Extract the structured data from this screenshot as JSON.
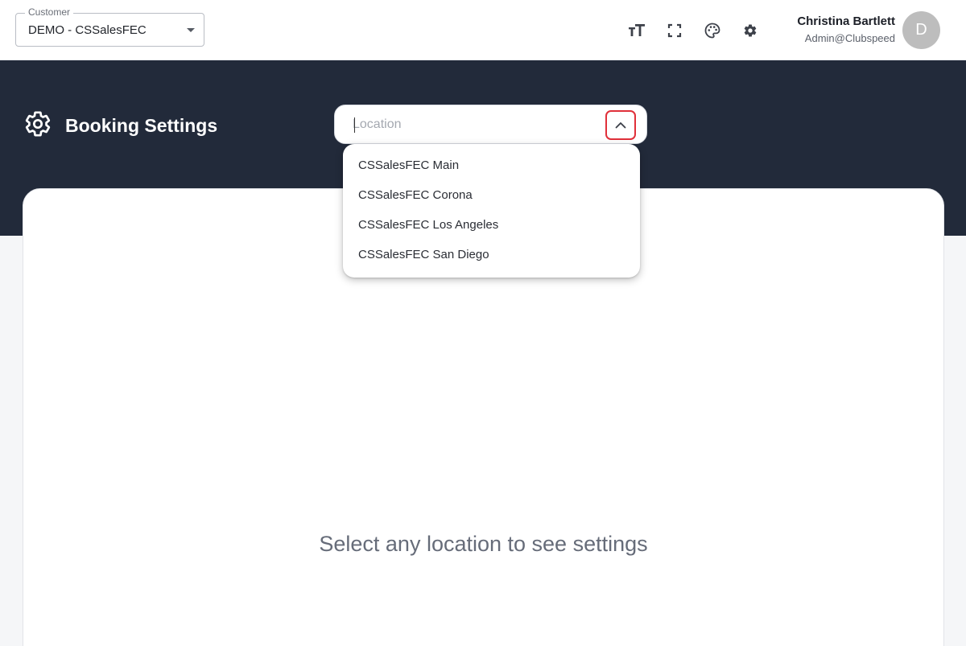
{
  "header": {
    "customer_select": {
      "label": "Customer",
      "value": "DEMO - CSSalesFEC"
    },
    "tools": [
      {
        "name": "text-size-icon"
      },
      {
        "name": "fullscreen-icon"
      },
      {
        "name": "palette-icon"
      },
      {
        "name": "gear-icon"
      }
    ],
    "user": {
      "name": "Christina Bartlett",
      "role": "Admin@Clubspeed",
      "avatar_initial": "D"
    }
  },
  "page": {
    "title": "Booking Settings",
    "title_icon": "gear-icon"
  },
  "location": {
    "placeholder": "Location",
    "value": "",
    "toggle_icon": "chevron-up-icon",
    "options": [
      "CSSalesFEC Main",
      "CSSalesFEC Corona",
      "CSSalesFEC Los Angeles",
      "CSSalesFEC San Diego"
    ]
  },
  "content": {
    "empty_message": "Select any location to see settings"
  },
  "colors": {
    "header_bg": "#ffffff",
    "hero_bg": "#222a3a",
    "page_bg": "#f5f6f8",
    "highlight": "#e0303a",
    "avatar_bg": "#bdbdbd"
  }
}
